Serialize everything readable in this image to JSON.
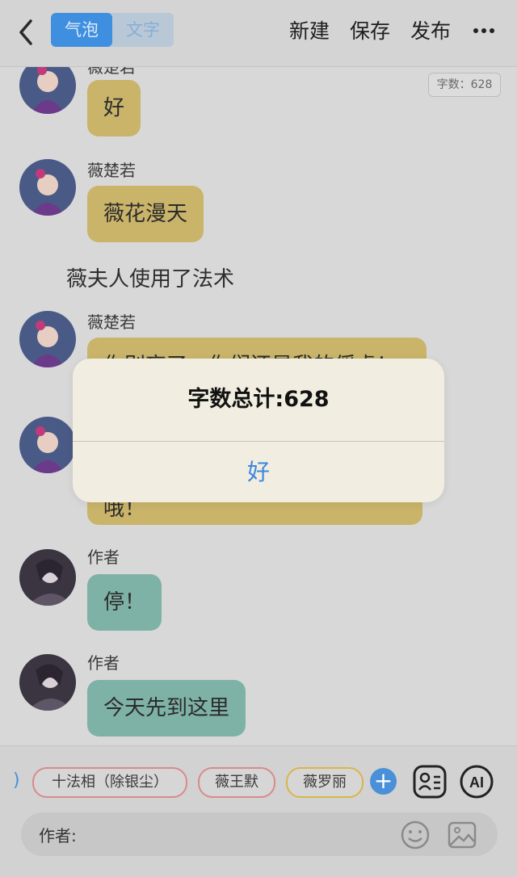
{
  "header": {
    "mode_tabs": [
      "气泡",
      "文字"
    ],
    "actions": [
      "新建",
      "保存",
      "发布"
    ]
  },
  "word_count_badge": "字数：628",
  "messages": [
    {
      "sender": "薇楚若",
      "text": "好"
    },
    {
      "sender": "薇楚若",
      "text": "薇花漫天"
    },
    {
      "narration": "薇夫人使用了法术"
    },
    {
      "sender": "薇楚若",
      "text": "你别忘了，你们还是我的俘虏！"
    },
    {
      "sender": "",
      "text": "哦！"
    },
    {
      "sender": "作者",
      "text": "停！"
    },
    {
      "sender": "作者",
      "text": "今天先到这里"
    }
  ],
  "character_chips": [
    "十法相（除银尘）",
    "薇王默",
    "薇罗丽"
  ],
  "input": {
    "prefix": "作者:"
  },
  "dialog": {
    "title": "字数总计:628",
    "button": "好"
  },
  "colors": {
    "accent": "#3f8fe0",
    "bubble_character": "#c9b46a",
    "bubble_author": "#7fb2a6",
    "dialog_bg": "#f1ede0"
  },
  "icons": [
    "back-chevron-icon",
    "more-icon",
    "add-icon",
    "contact-card-icon",
    "ai-icon",
    "smile-icon",
    "image-icon"
  ]
}
